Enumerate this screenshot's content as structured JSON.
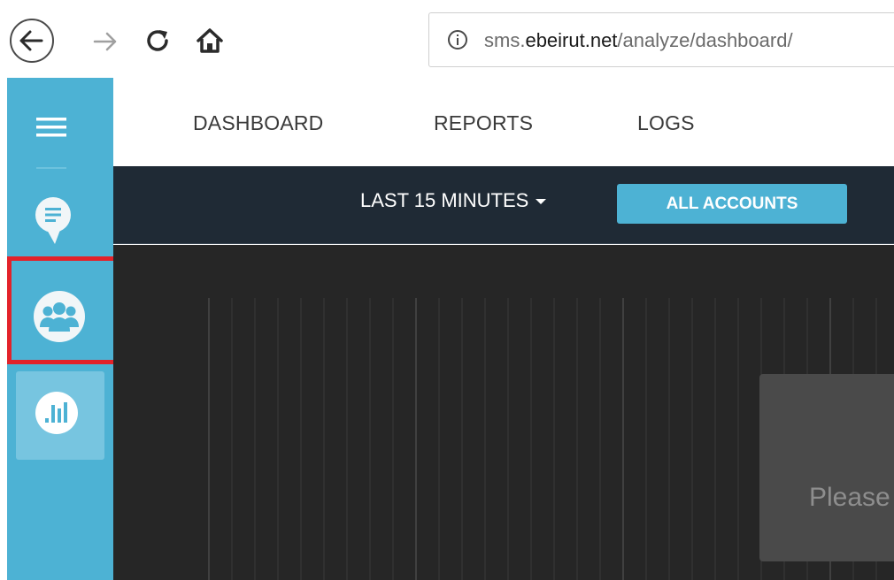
{
  "browser": {
    "url_prefix": "sms.",
    "url_domain": "ebeirut.net",
    "url_path": "/analyze/dashboard/"
  },
  "sidebar": {
    "items": [
      {
        "name": "menu",
        "icon": "hamburger-menu-icon"
      },
      {
        "name": "sms",
        "icon": "chat-bubble-icon"
      },
      {
        "name": "contacts",
        "icon": "group-icon",
        "highlighted": true
      },
      {
        "name": "analyze",
        "icon": "bar-chart-icon",
        "active": true
      }
    ],
    "color": "#4db2d4"
  },
  "nav": {
    "tabs": [
      "DASHBOARD",
      "REPORTS",
      "LOGS"
    ]
  },
  "filter": {
    "time_range": "LAST 15 MINUTES",
    "accounts_button": "ALL ACCOUNTS"
  },
  "content": {
    "loading_text": "Please"
  },
  "colors": {
    "accent": "#4db2d4",
    "highlight": "#e3222a",
    "filter_bar": "#1f2a35",
    "content_bg": "#262626"
  }
}
